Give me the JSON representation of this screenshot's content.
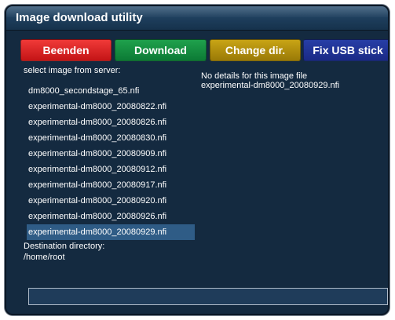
{
  "window": {
    "title": "Image download utility"
  },
  "buttons": {
    "red": "Beenden",
    "green": "Download",
    "yellow": "Change dir.",
    "blue": "Fix USB stick"
  },
  "image_list": {
    "label": "select image from server:",
    "items": [
      "dm8000_secondstage_65.nfi",
      "experimental-dm8000_20080822.nfi",
      "experimental-dm8000_20080826.nfi",
      "experimental-dm8000_20080830.nfi",
      "experimental-dm8000_20080909.nfi",
      "experimental-dm8000_20080912.nfi",
      "experimental-dm8000_20080917.nfi",
      "experimental-dm8000_20080920.nfi",
      "experimental-dm8000_20080926.nfi",
      "experimental-dm8000_20080929.nfi"
    ],
    "selected_index": 9
  },
  "details": {
    "line1": "No details for this image file",
    "line2": "experimental-dm8000_20080929.nfi"
  },
  "destination": {
    "label": "Destination directory:",
    "path": "/home/root"
  },
  "progress": {
    "fraction": 0
  },
  "colors": {
    "background": "#142a40",
    "selection": "#2f5c86",
    "red": "#d9201f",
    "green": "#148c3f",
    "yellow": "#b3900d",
    "blue": "#203496"
  }
}
